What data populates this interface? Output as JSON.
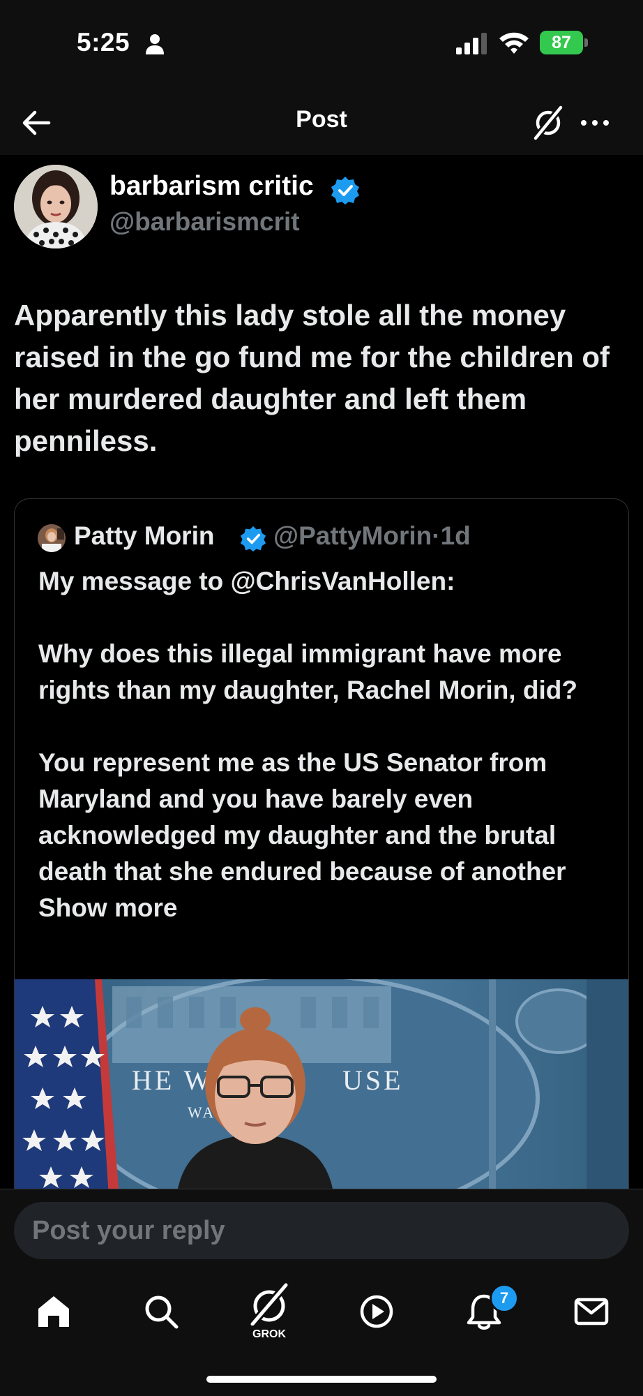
{
  "status_bar": {
    "time": "5:25",
    "battery": "87"
  },
  "header": {
    "title": "Post"
  },
  "post": {
    "author_name": "barbarism critic",
    "author_handle": "@barbarismcrit",
    "text": "Apparently this lady stole all the money raised in the go fund me for the children of her murdered daughter and left them penniless."
  },
  "quote": {
    "author_name": "Patty Morin",
    "author_handle": "@PattyMorin",
    "time": "1d",
    "separator": "·",
    "paragraphs": [
      "My message to @ChrisVanHollen:",
      "Why does this illegal immigrant have more rights than my daughter, Rachel Morin, did?",
      "You represent me as the US Senator from Maryland and you have barely even acknowledged my daughter and the brutal death that she endured because of another"
    ],
    "show_more": "Show more",
    "media": {
      "backdrop_text_left": "HE WH",
      "backdrop_text_right": "USE",
      "backdrop_subtext": "WASH"
    }
  },
  "reply": {
    "placeholder": "Post your reply"
  },
  "tab_bar": {
    "grok_label": "GROK",
    "notifications_count": "7",
    "tabs": [
      "home-icon",
      "search-icon",
      "grok-icon",
      "video-icon",
      "bell-icon",
      "mail-icon"
    ]
  },
  "colors": {
    "background": "#000000",
    "text_primary": "#e7e9ea",
    "text_secondary": "#71767b",
    "verified": "#1d9bf0",
    "battery": "#33c84e"
  }
}
